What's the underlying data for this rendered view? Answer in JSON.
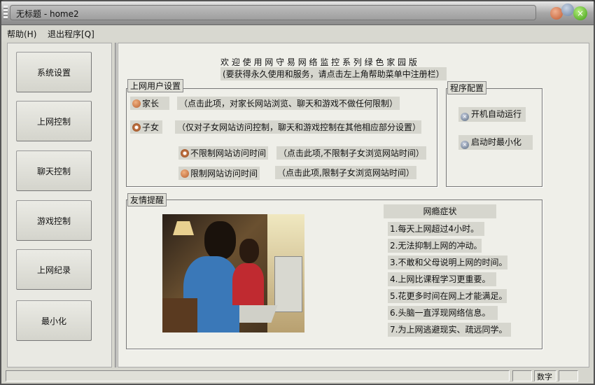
{
  "window": {
    "title": "无标题 - home2"
  },
  "menu": [
    "帮助(H)",
    "退出程序[Q]"
  ],
  "nav": [
    "系统设置",
    "上网控制",
    "聊天控制",
    "游戏控制",
    "上网纪录",
    "最小化"
  ],
  "banner": {
    "line1": "欢 迎 使 用 网 守 易 网 络 监 控 系 列 绿 色 家 园 版",
    "line2": "(要获得永久使用和服务，请点击左上角帮助菜单中注册栏）"
  },
  "user_settings": {
    "title": "上网用户设置",
    "parent": {
      "label": "家长",
      "desc": "（点击此项，对家长网站浏览、聊天和游戏不做任何限制）"
    },
    "child": {
      "label": "子女",
      "desc": "（仅对子女网站访问控制，聊天和游戏控制在其他相应部分设置）"
    },
    "unlimited": {
      "label": "不限制网站访问时间",
      "desc": "（点击此项,不限制子女浏览网站时间）"
    },
    "limited": {
      "label": "限制网站访问时间",
      "desc": "（点击此项,限制子女浏览网站时间）"
    }
  },
  "program_config": {
    "title": "程序配置",
    "autostart": "开机自动运行",
    "minimize_on_start": "启动时最小化"
  },
  "tips": {
    "title": "友情提醒",
    "heading": "网瘾症状",
    "items": [
      "1.每天上网超过4小时。",
      "2.无法抑制上网的冲动。",
      "3.不敢和父母说明上网的时间。",
      "4.上网比课程学习更重要。",
      "5.花更多时间在网上才能满足。",
      "6.头脑一直浮现网络信息。",
      "7.为上网逃避现实、疏远同学。"
    ]
  },
  "status": {
    "num": "数字"
  }
}
